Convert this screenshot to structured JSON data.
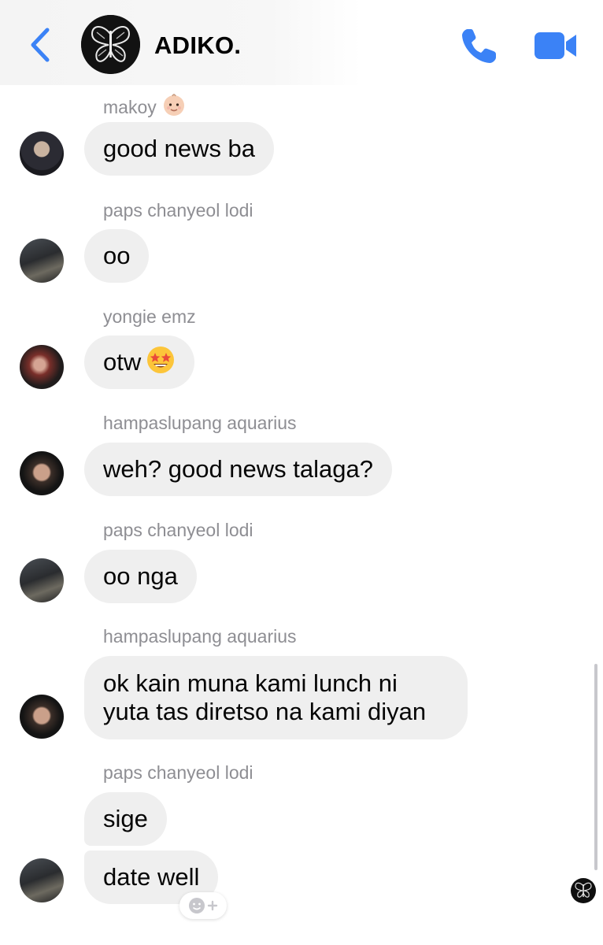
{
  "header": {
    "title": "ADIKO.",
    "back_icon": "chevron-left-icon",
    "call_icon": "phone-icon",
    "video_icon": "video-camera-icon",
    "accent_color": "#3b82f6"
  },
  "messages": [
    {
      "sender": "makoy",
      "sender_emoji": "baby-emoji",
      "text": "good news ba"
    },
    {
      "sender": "paps chanyeol lodi",
      "text": "oo"
    },
    {
      "sender": "yongie emz",
      "text": "otw",
      "text_emoji": "star-struck-emoji"
    },
    {
      "sender": "hampaslupang aquarius",
      "text": "weh? good news talaga?"
    },
    {
      "sender": "paps chanyeol lodi",
      "text": "oo nga"
    },
    {
      "sender": "hampaslupang aquarius",
      "text": "ok kain muna kami lunch ni yuta tas diretso na kami diyan"
    },
    {
      "sender": "paps chanyeol lodi",
      "texts": [
        "sige",
        "date well"
      ]
    }
  ],
  "reaction_button_icon": "add-reaction-icon",
  "bubble_color": "#efefef"
}
